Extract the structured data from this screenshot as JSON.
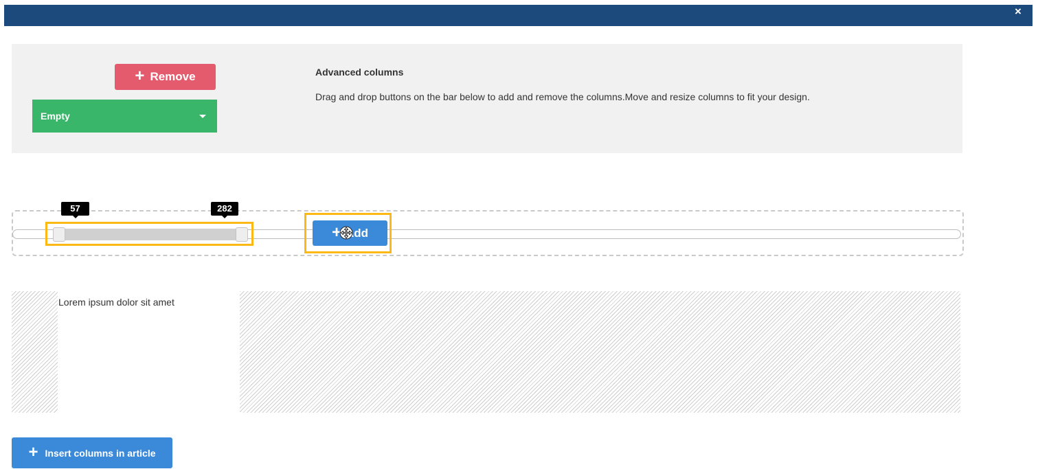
{
  "dialog": {
    "close_icon": "×"
  },
  "controls": {
    "remove_label": "Remove",
    "select_value": "Empty"
  },
  "info": {
    "title": "Advanced columns",
    "description": "Drag and drop buttons on the bar below to add and remove the columns.Move and resize columns to fit your design."
  },
  "slider": {
    "start_value": "57",
    "end_value": "282",
    "add_label": "Add"
  },
  "preview": {
    "column_text": "Lorem ipsum dolor sit amet"
  },
  "footer": {
    "insert_label": "Insert columns in article"
  },
  "colors": {
    "header": "#1c4a7c",
    "remove": "#e45b6d",
    "select": "#3ab66a",
    "primary": "#3b8ad9",
    "highlight": "#fcb814"
  }
}
